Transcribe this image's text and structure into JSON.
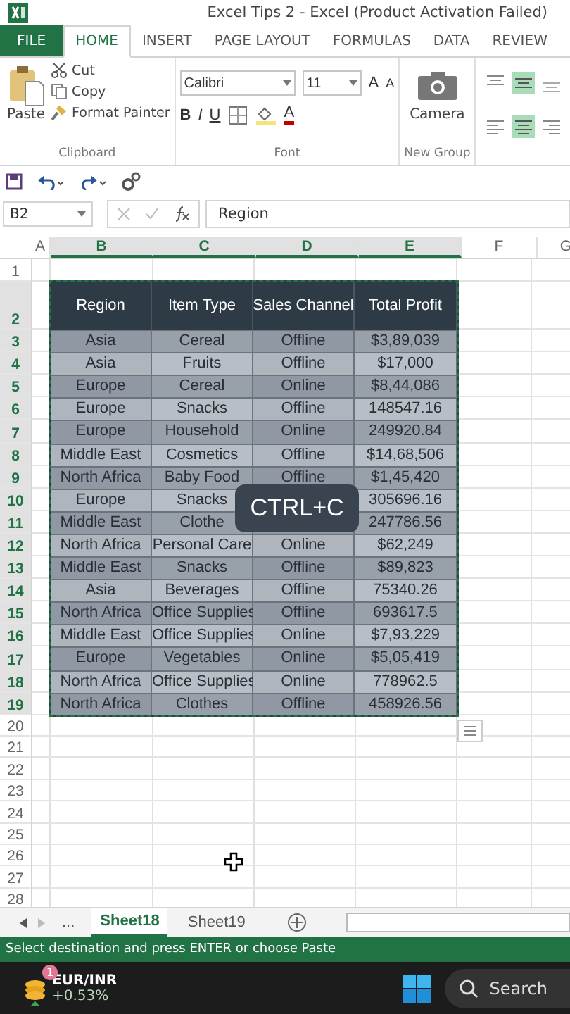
{
  "window": {
    "title": "Excel Tips 2 - Excel (Product Activation Failed)"
  },
  "tabs": [
    {
      "label": "FILE",
      "kind": "file",
      "selected": false
    },
    {
      "label": "HOME",
      "kind": "tab",
      "selected": true
    },
    {
      "label": "INSERT",
      "kind": "tab",
      "selected": false
    },
    {
      "label": "PAGE LAYOUT",
      "kind": "tab",
      "selected": false
    },
    {
      "label": "FORMULAS",
      "kind": "tab",
      "selected": false
    },
    {
      "label": "DATA",
      "kind": "tab",
      "selected": false
    },
    {
      "label": "REVIEW",
      "kind": "tab",
      "selected": false
    }
  ],
  "ribbon": {
    "clipboard": {
      "paste": "Paste",
      "cut": "Cut",
      "copy": "Copy",
      "format_painter": "Format Painter",
      "label": "Clipboard"
    },
    "font": {
      "family": "Calibri",
      "size": "11",
      "grow": "A",
      "shrink": "A",
      "bold": "B",
      "italic": "I",
      "underline": "U",
      "font_color_button": "A",
      "label": "Font"
    },
    "new_group": {
      "camera": "Camera",
      "label": "New Group"
    }
  },
  "name_box": "B2",
  "formula": "Region",
  "columns": [
    "A",
    "B",
    "C",
    "D",
    "E",
    "F",
    "G"
  ],
  "row_numbers": [
    "1",
    "2",
    "3",
    "4",
    "5",
    "6",
    "7",
    "8",
    "9",
    "10",
    "11",
    "12",
    "13",
    "14",
    "15",
    "16",
    "17",
    "18",
    "19",
    "20",
    "21",
    "22",
    "23",
    "24",
    "25",
    "26",
    "27",
    "28"
  ],
  "table": {
    "headers": [
      "Region",
      "Item Type",
      "Sales Channel",
      "Total Profit"
    ],
    "rows": [
      [
        "Asia",
        "Cereal",
        "Offline",
        "$3,89,039"
      ],
      [
        "Asia",
        "Fruits",
        "Offline",
        "$17,000"
      ],
      [
        "Europe",
        "Cereal",
        "Online",
        "$8,44,086"
      ],
      [
        "Europe",
        "Snacks",
        "Offline",
        "148547.16"
      ],
      [
        "Europe",
        "Household",
        "Online",
        "249920.84"
      ],
      [
        "Middle East",
        "Cosmetics",
        "Offline",
        "$14,68,506"
      ],
      [
        "North Africa",
        "Baby Food",
        "Offline",
        "$1,45,420"
      ],
      [
        "Europe",
        "Snacks",
        null,
        "305696.16"
      ],
      [
        "Middle East",
        "Clothe",
        null,
        "247786.56"
      ],
      [
        "North Africa",
        "Personal Care",
        "Online",
        "$62,249"
      ],
      [
        "Middle East",
        "Snacks",
        "Offline",
        "$89,823"
      ],
      [
        "Asia",
        "Beverages",
        "Offline",
        "75340.26"
      ],
      [
        "North Africa",
        "Office Supplies",
        "Offline",
        "693617.5"
      ],
      [
        "Middle East",
        "Office Supplies",
        "Online",
        "$7,93,229"
      ],
      [
        "Europe",
        "Vegetables",
        "Online",
        "$5,05,419"
      ],
      [
        "North Africa",
        "Office Supplies",
        "Online",
        "778962.5"
      ],
      [
        "North Africa",
        "Clothes",
        "Offline",
        "458926.56"
      ]
    ]
  },
  "overlay": "CTRL+C",
  "sheet_tabs": [
    {
      "label": "...",
      "kind": "more",
      "selected": false
    },
    {
      "label": "Sheet18",
      "kind": "sheet",
      "selected": true
    },
    {
      "label": "Sheet19",
      "kind": "sheet",
      "selected": false
    }
  ],
  "status_bar": "Select destination and press ENTER or choose Paste",
  "taskbar": {
    "badge": "1",
    "ticker": "EUR/INR",
    "change": "+0.53%",
    "search": "Search"
  }
}
